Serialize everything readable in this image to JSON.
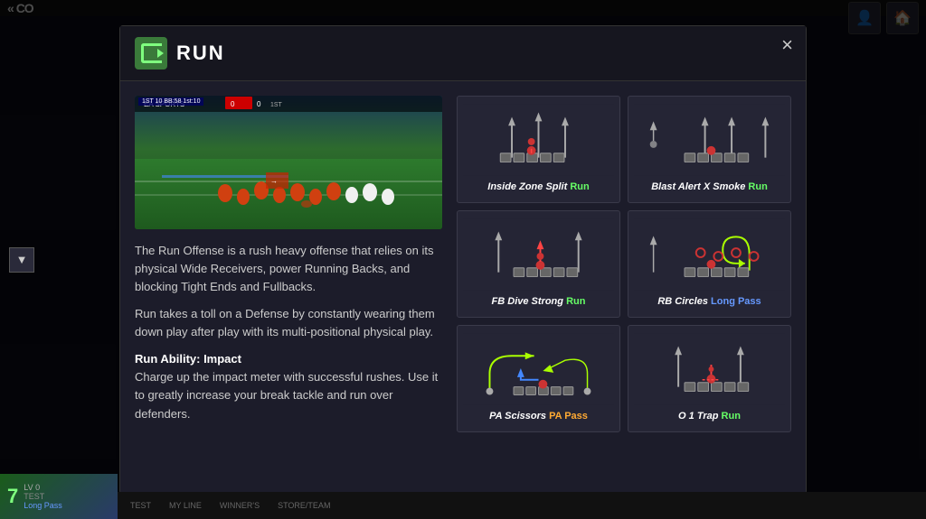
{
  "app": {
    "title": "CO",
    "logo_text": "CO"
  },
  "header": {
    "top_icons": [
      "person",
      "home"
    ]
  },
  "modal": {
    "icon_alt": "run-icon",
    "title": "RUN",
    "close_label": "×",
    "screenshot_hud": "1ST 10 BB:58 1st:10",
    "description": {
      "para1": "The Run Offense is a rush heavy offense that relies on its physical Wide Receivers, power Running Backs, and blocking Tight Ends and Fullbacks.",
      "para2": "Run takes a toll on a Defense by constantly wearing them down play after play with its multi-positional physical play.",
      "para3_label": "Run Ability: Impact",
      "para3": "Charge up the impact meter with successful rushes. Use it to greatly increase your break tackle and run over defenders."
    },
    "plays": [
      {
        "name": "Inside Zone Split",
        "type": "Run",
        "type_color": "run",
        "diagram": "inside_zone_split"
      },
      {
        "name": "Blast Alert X Smoke",
        "type": "Run",
        "type_color": "run",
        "diagram": "blast_alert"
      },
      {
        "name": "FB Dive Strong",
        "type": "Run",
        "type_color": "run",
        "diagram": "fb_dive"
      },
      {
        "name": "RB Circles",
        "type": "Long Pass",
        "type_color": "long-pass",
        "diagram": "rb_circles"
      },
      {
        "name": "PA Scissors",
        "type": "PA Pass",
        "type_color": "pa-pass",
        "diagram": "pa_scissors"
      },
      {
        "name": "O 1 Trap",
        "type": "Run",
        "type_color": "run",
        "diagram": "o1_trap"
      }
    ]
  },
  "sidebar": {
    "filter_icon": "▼"
  },
  "bottom_player": {
    "number": "7",
    "level": "LV 0",
    "card_type": "TEST",
    "play_label": "Long Pass"
  },
  "bottom_tabs": [
    "TEST",
    "MY LINE",
    "WINNER'S",
    "STORE/TEAM"
  ]
}
